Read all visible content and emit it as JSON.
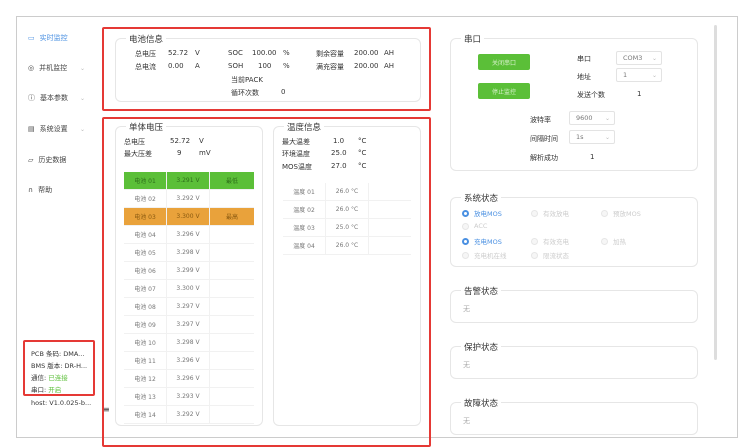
{
  "sidebar": {
    "items": [
      {
        "label": "实时监控",
        "icon": "monitor-icon",
        "active": true
      },
      {
        "label": "并机监控",
        "icon": "eye-icon",
        "chevron": true
      },
      {
        "label": "基本参数",
        "icon": "info-circle-icon",
        "chevron": true
      },
      {
        "label": "系统设置",
        "icon": "settings-icon",
        "chevron": true
      },
      {
        "label": "历史数据",
        "icon": "folder-icon"
      },
      {
        "label": "帮助",
        "icon": "headset-icon"
      }
    ],
    "info": {
      "pcb": "PCB 条码: DMA...",
      "bms": "BMS 版本: DR-H...",
      "comm_label": "通信:",
      "comm_value": "已连接",
      "port_label": "串口:",
      "port_value": "开启",
      "host": "host: V1.0.025-b..."
    }
  },
  "battery": {
    "title": "电池信息",
    "total_voltage_label": "总电压",
    "total_voltage": "52.72",
    "total_voltage_unit": "V",
    "total_current_label": "总电流",
    "total_current": "0.00",
    "total_current_unit": "A",
    "soc_label": "SOC",
    "soc": "100.00",
    "soc_unit": "%",
    "soh_label": "SOH",
    "soh": "100",
    "soh_unit": "%",
    "remain_label": "剩余容量",
    "remain": "200.00",
    "remain_unit": "AH",
    "full_label": "满充容量",
    "full": "200.00",
    "full_unit": "AH",
    "pack_label": "当前PACK",
    "cycles_label": "循环次数",
    "cycles": "0"
  },
  "cells": {
    "title": "单体电压",
    "total_label": "总电压",
    "total": "52.72",
    "total_unit": "V",
    "diff_label": "最大压差",
    "diff": "9",
    "diff_unit": "mV",
    "rows": [
      {
        "name": "电池 01",
        "v": "3.291 V",
        "tag": "最低",
        "state": "green"
      },
      {
        "name": "电池 02",
        "v": "3.292 V",
        "tag": ""
      },
      {
        "name": "电池 03",
        "v": "3.300 V",
        "tag": "最高",
        "state": "orange"
      },
      {
        "name": "电池 04",
        "v": "3.296 V",
        "tag": ""
      },
      {
        "name": "电池 05",
        "v": "3.298 V",
        "tag": ""
      },
      {
        "name": "电池 06",
        "v": "3.299 V",
        "tag": ""
      },
      {
        "name": "电池 07",
        "v": "3.300 V",
        "tag": ""
      },
      {
        "name": "电池 08",
        "v": "3.297 V",
        "tag": ""
      },
      {
        "name": "电池 09",
        "v": "3.297 V",
        "tag": ""
      },
      {
        "name": "电池 10",
        "v": "3.298 V",
        "tag": ""
      },
      {
        "name": "电池 11",
        "v": "3.296 V",
        "tag": ""
      },
      {
        "name": "电池 12",
        "v": "3.296 V",
        "tag": ""
      },
      {
        "name": "电池 13",
        "v": "3.293 V",
        "tag": ""
      },
      {
        "name": "电池 14",
        "v": "3.292 V",
        "tag": ""
      }
    ]
  },
  "temps": {
    "title": "温度信息",
    "max_diff_label": "最大温差",
    "max_diff": "1.0",
    "env_label": "环境温度",
    "env": "25.0",
    "mos_label": "MOS温度",
    "mos": "27.0",
    "unit": "°C",
    "rows": [
      {
        "name": "温度 01",
        "v": "26.0 °C"
      },
      {
        "name": "温度 02",
        "v": "26.0 °C"
      },
      {
        "name": "温度 03",
        "v": "25.0 °C"
      },
      {
        "name": "温度 04",
        "v": "26.0 °C"
      }
    ]
  },
  "serial": {
    "title": "串口",
    "close_btn": "关闭串口",
    "stop_btn": "停止监控",
    "port_label": "串口",
    "port": "COM3",
    "addr_label": "地址",
    "addr": "1",
    "sent_label": "发送个数",
    "sent": "1",
    "baud_label": "波特率",
    "baud": "9600",
    "interval_label": "间隔时间",
    "interval": "1s",
    "parsed_label": "解析成功",
    "parsed": "1"
  },
  "system": {
    "title": "系统状态",
    "items": [
      {
        "label": "放电MOS",
        "on": true
      },
      {
        "label": "有效放电",
        "on": false
      },
      {
        "label": "预放MOS",
        "on": false
      },
      {
        "label": "ACC",
        "on": false
      },
      {
        "label": "充电MOS",
        "on": true
      },
      {
        "label": "有效充电",
        "on": false
      },
      {
        "label": "加热",
        "on": false
      },
      {
        "label": "充电机在线",
        "on": false
      },
      {
        "label": "限流状态",
        "on": false
      }
    ]
  },
  "alarm": {
    "title": "告警状态",
    "value": "无"
  },
  "protect": {
    "title": "保护状态",
    "value": "无"
  },
  "fault": {
    "title": "故障状态",
    "value": "无"
  },
  "colors": {
    "accent": "#4a90e2",
    "green": "#5bbf38",
    "orange": "#e9a23b",
    "highlight": "#e53935"
  }
}
